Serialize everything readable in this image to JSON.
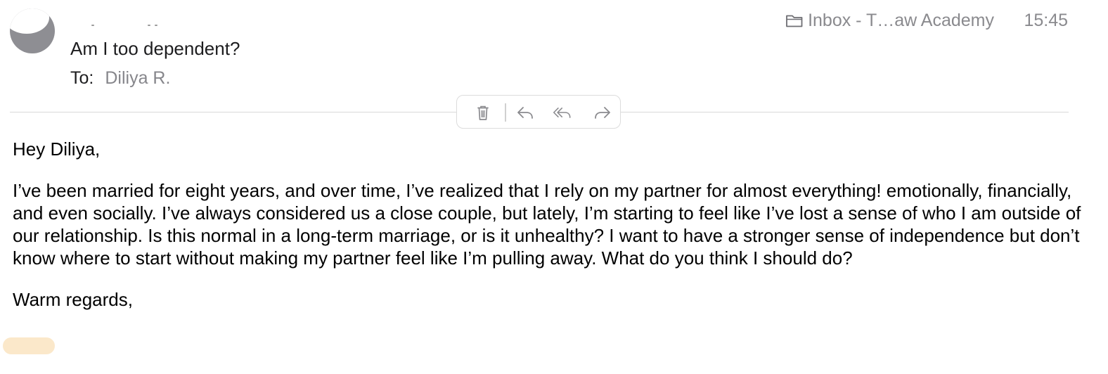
{
  "header": {
    "subject": "Am I too dependent?",
    "to_label": "To:",
    "to_value": "Diliya R.",
    "mailbox": "Inbox - T…aw Academy",
    "time": "15:45"
  },
  "icons": {
    "avatar": "avatar",
    "folder": "folder-icon",
    "trash": "trash-icon",
    "reply": "reply-icon",
    "reply_all": "reply-all-icon",
    "forward": "forward-icon"
  },
  "body": {
    "greeting": "Hey Diliya,",
    "paragraph": "I’ve been married for eight years, and over time, I’ve realized that I rely on my partner for almost everything! emotionally, financially, and even socially. I’ve always considered us a close couple, but lately, I’m starting to feel like I’ve lost a sense of who I am outside of our relationship. Is this normal in a long-term marriage, or is it unhealthy? I want to have a stronger sense of independence but don’t know where to start without making my partner feel like I’m pulling away. What do you think I should do?",
    "closing": "Warm regards,"
  },
  "colors": {
    "secondary_text": "#8a8a8e",
    "divider": "#d9d9d9",
    "avatar_gray": "#8e8e93",
    "signature_highlight": "#fbe6c4"
  }
}
